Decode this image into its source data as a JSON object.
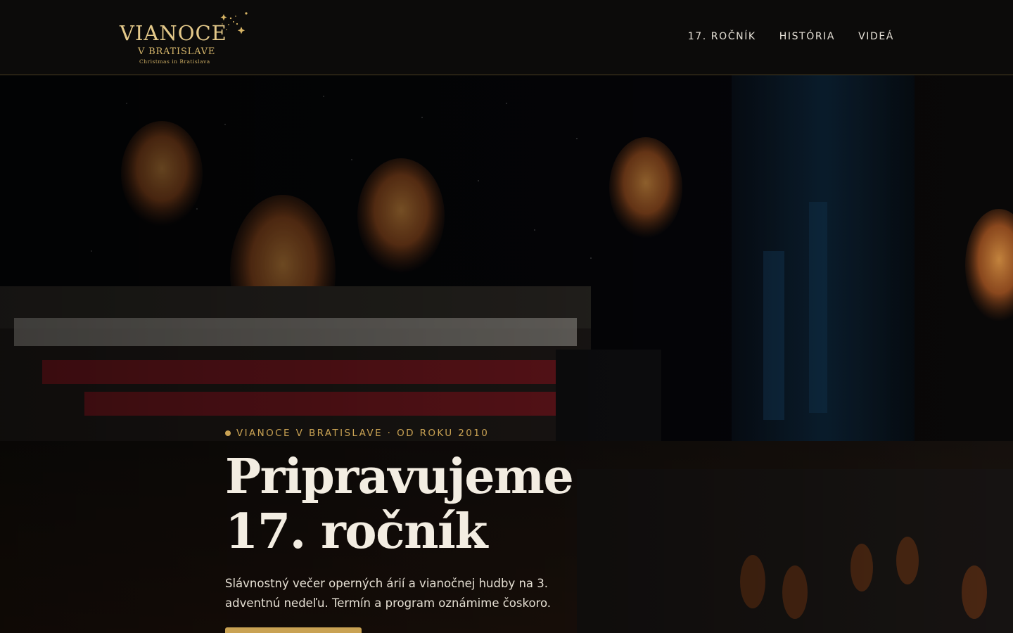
{
  "logo": {
    "main": "Vianoce",
    "sub": "V Bratislave",
    "tagline": "Christmas in Bratislava"
  },
  "nav": {
    "items": [
      {
        "label": "17. ročník"
      },
      {
        "label": "História"
      },
      {
        "label": "Videá"
      }
    ]
  },
  "hero": {
    "eyebrow": "Vianoce v Bratislave · od roku 2010",
    "title_line1": "Pripravujeme",
    "title_line2": "17. ročník",
    "description": "Slávnostný večer operných árií a vianočnej hudby na 3. adventnú nedeľu. Termín a program oznámime čoskoro.",
    "cta_label": ""
  },
  "colors": {
    "background": "#0b0a09",
    "accent_gold": "#c9a253",
    "text_light": "#f3ede2"
  }
}
